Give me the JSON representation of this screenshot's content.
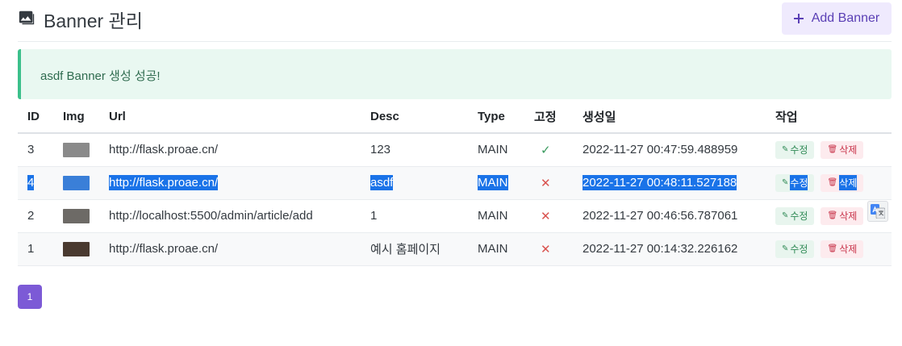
{
  "header": {
    "title": "Banner 관리",
    "add_button": "Add Banner",
    "add_icon": "plus-icon",
    "title_icon": "image-icon"
  },
  "alert": {
    "message": "asdf Banner 생성 성공!"
  },
  "table": {
    "columns": [
      "ID",
      "Img",
      "Url",
      "Desc",
      "Type",
      "고정",
      "생성일",
      "작업"
    ],
    "rows": [
      {
        "id": "3",
        "url": "http://flask.proae.cn/",
        "desc": "123",
        "type": "MAIN",
        "fixed": "✓",
        "created": "2022-11-27 00:47:59.488959",
        "thumb_color": "#8a8a8a"
      },
      {
        "id": "4",
        "url": "http://flask.proae.cn/",
        "desc": "asdf",
        "type": "MAIN",
        "fixed": "✕",
        "created": "2022-11-27 00:48:11.527188",
        "thumb_color": "#3a7fd8"
      },
      {
        "id": "2",
        "url": "http://localhost:5500/admin/article/add",
        "desc": "1",
        "type": "MAIN",
        "fixed": "✕",
        "created": "2022-11-27 00:46:56.787061",
        "thumb_color": "#6d6a66"
      },
      {
        "id": "1",
        "url": "http://flask.proae.cn/",
        "desc": "예시 홈페이지",
        "type": "MAIN",
        "fixed": "✕",
        "created": "2022-11-27 00:14:32.226162",
        "thumb_color": "#4a3a30"
      }
    ],
    "edit_label": "수정",
    "delete_label": "삭제",
    "edit_icon": "edit-icon",
    "delete_icon": "trash-icon"
  },
  "pagination": {
    "current": "1"
  },
  "colors": {
    "accent": "#7c5ad6",
    "success": "#3cc08b",
    "danger": "#c8344a",
    "selection": "#1a73e8"
  }
}
